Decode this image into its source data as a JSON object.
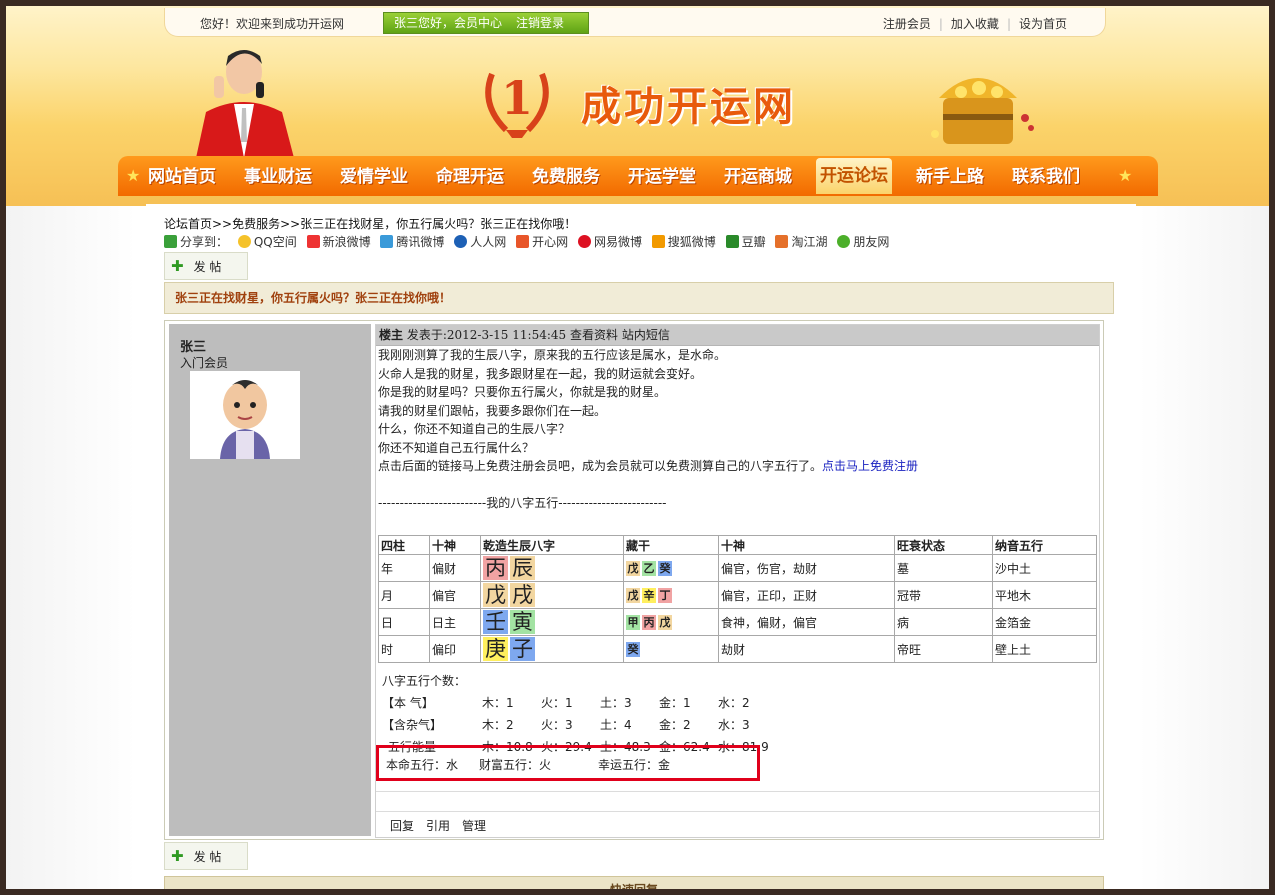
{
  "topbar": {
    "welcome": "您好！欢迎来到成功开运网",
    "member_greeting": "张三您好，会员中心",
    "logout": "注销登录",
    "links": [
      "注册会员",
      "加入收藏",
      "设为首页"
    ]
  },
  "site": {
    "logo_number": "1",
    "name": "成功开运网"
  },
  "nav": {
    "items": [
      "网站首页",
      "事业财运",
      "爱情学业",
      "命理开运",
      "免费服务",
      "开运学堂",
      "开运商城",
      "开运论坛",
      "新手上路",
      "联系我们"
    ],
    "active_index": 7
  },
  "breadcrumb": "论坛首页>>免费服务>>张三正在找财星，你五行属火吗？张三正在找你哦！",
  "share": {
    "label": "分享到：",
    "targets": [
      "QQ空间",
      "新浪微博",
      "腾讯微博",
      "人人网",
      "开心网",
      "网易微博",
      "搜狐微博",
      "豆瓣",
      "淘江湖",
      "朋友网"
    ]
  },
  "post_button": "发 帖",
  "thread_title": "张三正在找财星，你五行属火吗？张三正在找你哦！",
  "author": {
    "name": "张三",
    "level": "入门会员"
  },
  "post": {
    "floor": "楼主",
    "posted_at": "发表于:2012-3-15 11:54:45",
    "profile_link": "查看资料",
    "pm_link": "站内短信",
    "lines": [
      "我刚刚测算了我的生辰八字，原来我的五行应该是属水，是水命。",
      "火命人是我的财星，我多跟财星在一起，我的财运就会变好。",
      "你是我的财星吗？只要你五行属火，你就是我的财星。",
      "请我的财星们跟帖，我要多跟你们在一起。",
      "什么，你还不知道自己的生辰八字？",
      "你还不知道自己五行属什么？"
    ],
    "cta_text": "点击后面的链接马上免费注册会员吧，成为会员就可以免费测算自己的八字五行了。",
    "cta_link": "点击马上免费注册",
    "section_divider": "-------------------------我的八字五行-------------------------"
  },
  "bazi_table": {
    "headers": [
      "四柱",
      "十神",
      "乾造生辰八字",
      "藏干",
      "十神",
      "旺衰状态",
      "纳音五行"
    ],
    "rows": [
      {
        "pillar": "年",
        "god": "偏财",
        "stem": "丙",
        "branch": "辰",
        "hidden": [
          "戊",
          "乙",
          "癸"
        ],
        "hidden_gods": "偏官，伤官，劫财",
        "state": "墓",
        "nayin": "沙中土"
      },
      {
        "pillar": "月",
        "god": "偏官",
        "stem": "戊",
        "branch": "戌",
        "hidden": [
          "戊",
          "辛",
          "丁"
        ],
        "hidden_gods": "偏官，正印，正财",
        "state": "冠带",
        "nayin": "平地木"
      },
      {
        "pillar": "日",
        "god": "日主",
        "stem": "壬",
        "branch": "寅",
        "hidden": [
          "甲",
          "丙",
          "戊"
        ],
        "hidden_gods": "食神，偏财，偏官",
        "state": "病",
        "nayin": "金箔金"
      },
      {
        "pillar": "时",
        "god": "偏印",
        "stem": "庚",
        "branch": "子",
        "hidden": [
          "癸"
        ],
        "hidden_gods": "劫财",
        "state": "帝旺",
        "nayin": "壁上土"
      }
    ]
  },
  "element_colors": {
    "fire": "#f1a3a3",
    "earth": "#f2d6a0",
    "water": "#7ea8ef",
    "wood": "#a3e3a3",
    "metal": "#ffef5e"
  },
  "counts": {
    "title": "八字五行个数：",
    "rows": [
      {
        "label": "【本  气】",
        "values": [
          "木：1",
          "火：1",
          "土：3",
          "金：1",
          "水：2"
        ]
      },
      {
        "label": "【含杂气】",
        "values": [
          "木：2",
          "火：3",
          "土：4",
          "金：2",
          "水：3"
        ]
      },
      {
        "label": "五行能量",
        "values": [
          "木：10.8",
          "火：29.4",
          "土：48.3",
          "金：62.4",
          "水：81.9"
        ]
      }
    ]
  },
  "destiny": {
    "life": "本命五行：水",
    "wealth": "财富五行：火",
    "luck": "幸运五行：金"
  },
  "post_actions": [
    "回复",
    "引用",
    "管理"
  ],
  "quick_reply": "快速回复",
  "accent_colors": {
    "nav_orange": "#f26a00",
    "highlight_red": "#e0001b",
    "member_green": "#5fa315",
    "link_blue": "#1a22c0"
  }
}
